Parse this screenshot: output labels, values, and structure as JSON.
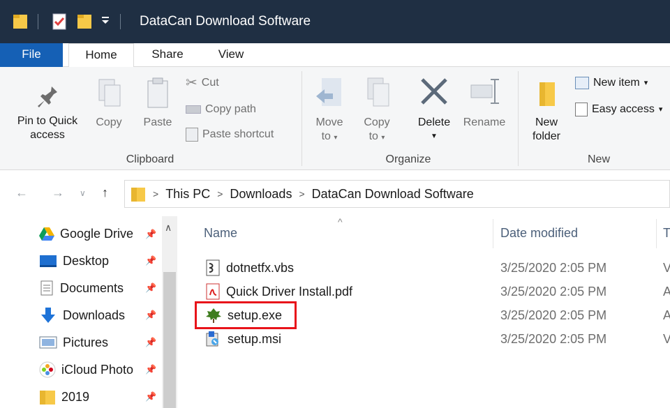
{
  "window": {
    "title": "DataCan Download Software"
  },
  "menu_tabs": {
    "file": "File",
    "home": "Home",
    "share": "Share",
    "view": "View"
  },
  "ribbon": {
    "clipboard": {
      "pin_line1": "Pin to Quick",
      "pin_line2": "access",
      "copy": "Copy",
      "paste": "Paste",
      "cut": "Cut",
      "copy_path": "Copy path",
      "paste_shortcut": "Paste shortcut",
      "label": "Clipboard"
    },
    "organize": {
      "move_to_line1": "Move",
      "move_to_line2": "to",
      "copy_to_line1": "Copy",
      "copy_to_line2": "to",
      "delete": "Delete",
      "rename": "Rename",
      "label": "Organize"
    },
    "new": {
      "new_folder_line1": "New",
      "new_folder_line2": "folder",
      "new_item": "New item",
      "easy_access": "Easy access",
      "label": "New"
    }
  },
  "address": {
    "crumbs": [
      "This PC",
      "Downloads",
      "DataCan Download Software"
    ]
  },
  "nav_pane": {
    "items": [
      {
        "label": "Google Drive",
        "icon": "google-drive-icon"
      },
      {
        "label": "Desktop",
        "icon": "desktop-icon"
      },
      {
        "label": "Documents",
        "icon": "documents-icon"
      },
      {
        "label": "Downloads",
        "icon": "downloads-icon"
      },
      {
        "label": "Pictures",
        "icon": "pictures-icon"
      },
      {
        "label": "iCloud Photo",
        "icon": "icloud-photo-icon"
      },
      {
        "label": "2019",
        "icon": "folder-icon"
      }
    ]
  },
  "file_list": {
    "columns": {
      "name": "Name",
      "date_modified": "Date modified",
      "type_partial": "T"
    },
    "rows": [
      {
        "name": "dotnetfx.vbs",
        "date": "3/25/2020 2:05 PM",
        "type_partial": "V",
        "icon": "vbs-script-icon"
      },
      {
        "name": "Quick Driver Install.pdf",
        "date": "3/25/2020 2:05 PM",
        "type_partial": "A",
        "icon": "pdf-icon"
      },
      {
        "name": "setup.exe",
        "date": "3/25/2020 2:05 PM",
        "type_partial": "A",
        "icon": "setup-exe-icon"
      },
      {
        "name": "setup.msi",
        "date": "3/25/2020 2:05 PM",
        "type_partial": "V",
        "icon": "msi-installer-icon"
      }
    ]
  },
  "colors": {
    "titlebar": "#1f2f43",
    "file_tab": "#1560b5",
    "highlight": "#e8131a"
  }
}
